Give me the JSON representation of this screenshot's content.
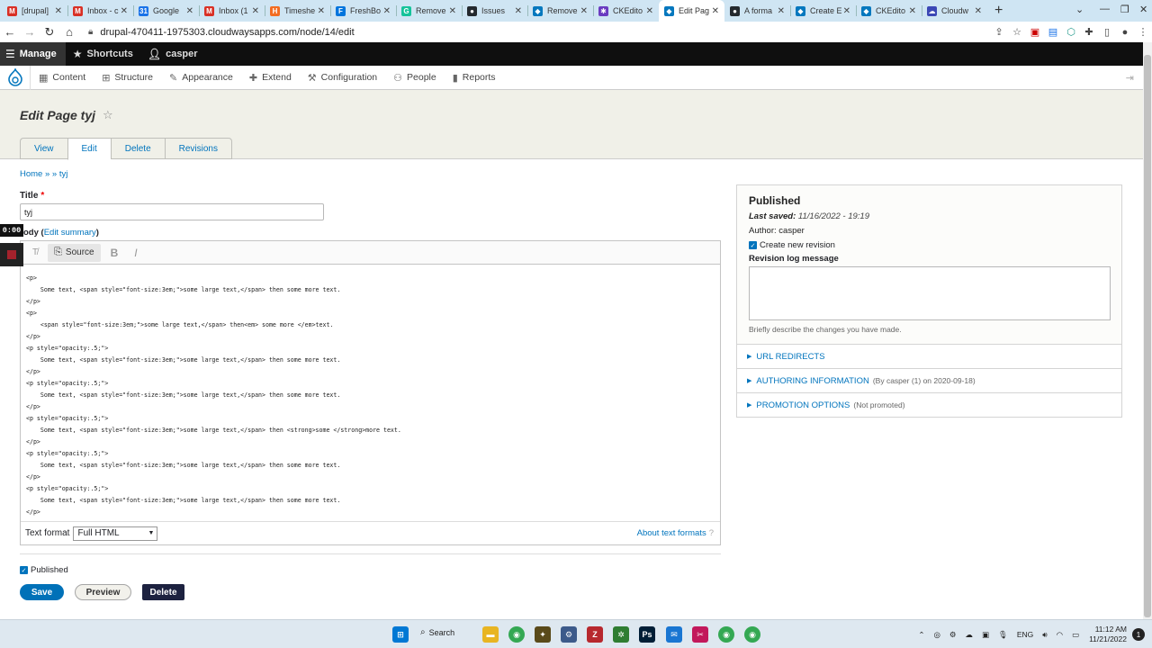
{
  "browser": {
    "tabs": [
      {
        "label": "[drupal]",
        "icon": "gmail-icon",
        "color": "#d93025",
        "glyph": "M"
      },
      {
        "label": "Inbox - c",
        "icon": "gmail-icon",
        "color": "#d93025",
        "glyph": "M"
      },
      {
        "label": "Google",
        "icon": "calendar-icon",
        "color": "#1a73e8",
        "glyph": "31"
      },
      {
        "label": "Inbox (1",
        "icon": "gmail-icon",
        "color": "#d93025",
        "glyph": "M"
      },
      {
        "label": "Timeshe",
        "icon": "harvest-icon",
        "color": "#f36c21",
        "glyph": "H"
      },
      {
        "label": "FreshBo",
        "icon": "freshbooks-icon",
        "color": "#0075dd",
        "glyph": "F"
      },
      {
        "label": "Remove",
        "icon": "grammarly-icon",
        "color": "#15c39a",
        "glyph": "G"
      },
      {
        "label": "Issues",
        "icon": "github-icon",
        "color": "#24292e",
        "glyph": "●"
      },
      {
        "label": "Remove",
        "icon": "drupal-icon",
        "color": "#0678be",
        "glyph": "◆"
      },
      {
        "label": "CKEdito",
        "icon": "ckeditor-icon",
        "color": "#6a3bc0",
        "glyph": "✱"
      },
      {
        "label": "Edit Pag",
        "icon": "drupal-icon",
        "color": "#0678be",
        "glyph": "◆",
        "active": true
      },
      {
        "label": "A forma",
        "icon": "github-icon",
        "color": "#24292e",
        "glyph": "●"
      },
      {
        "label": "Create E",
        "icon": "drupal-icon",
        "color": "#0678be",
        "glyph": "◆"
      },
      {
        "label": "CKEdito",
        "icon": "drupal-icon",
        "color": "#0678be",
        "glyph": "◆"
      },
      {
        "label": "Cloudw",
        "icon": "cloudways-icon",
        "color": "#3b47b5",
        "glyph": "☁"
      }
    ],
    "url": "drupal-470411-1975303.cloudwaysapps.com/node/14/edit"
  },
  "toolbar": {
    "manage": "Manage",
    "shortcuts": "Shortcuts",
    "user": "casper"
  },
  "tray": {
    "items": [
      "Content",
      "Structure",
      "Appearance",
      "Extend",
      "Configuration",
      "People",
      "Reports"
    ]
  },
  "page": {
    "title": "Edit Page tyj",
    "tabs": [
      "View",
      "Edit",
      "Delete",
      "Revisions"
    ],
    "breadcrumb": "Home » » tyj"
  },
  "form": {
    "title_label": "Title",
    "title_required": "*",
    "title_value": "tyj",
    "body_label": "ody (",
    "edit_summary": "Edit summary",
    "body_close": ")",
    "recorder_time": "0:00",
    "source_label": "Source",
    "source_lines": [
      "<p>",
      "    Some text, <span style=\"font-size:3em;\">some large text,</span> then some more text.",
      "</p>",
      "<p>",
      "    <span style=\"font-size:3em;\">some large text,</span> then<em> some more </em>text.",
      "</p>",
      "<p style=\"opacity:.5;\">",
      "    Some text, <span style=\"font-size:3em;\">some large text,</span> then some more text.",
      "</p>",
      "<p style=\"opacity:.5;\">",
      "    Some text, <span style=\"font-size:3em;\">some large text,</span> then some more text.",
      "</p>",
      "<p style=\"opacity:.5;\">",
      "    Some text, <span style=\"font-size:3em;\">some large text,</span> then <strong>some </strong>more text.",
      "</p>",
      "<p style=\"opacity:.5;\">",
      "    Some text, <span style=\"font-size:3em;\">some large text,</span> then some more text.",
      "</p>",
      "<p style=\"opacity:.5;\">",
      "    Some text, <span style=\"font-size:3em;\">some large text,</span> then some more text.",
      "</p>"
    ],
    "text_format_label": "Text format",
    "text_format_value": "Full HTML",
    "about_formats": "About text formats",
    "published_label": "Published",
    "save": "Save",
    "preview": "Preview",
    "delete": "Delete"
  },
  "sidebar": {
    "status": "Published",
    "last_saved_label": "Last saved:",
    "last_saved_value": "11/16/2022 - 19:19",
    "author_label": "Author:",
    "author_value": "casper",
    "new_revision": "Create new revision",
    "log_label": "Revision log message",
    "log_desc": "Briefly describe the changes you have made.",
    "details": [
      {
        "title": "URL REDIRECTS",
        "summary": ""
      },
      {
        "title": "AUTHORING INFORMATION",
        "summary": "(By casper (1) on 2020-09-18)"
      },
      {
        "title": "PROMOTION OPTIONS",
        "summary": "(Not promoted)"
      }
    ]
  },
  "taskbar": {
    "search": "Search",
    "lang": "ENG",
    "time": "11:12 AM",
    "date": "11/21/2022",
    "notifications": "1"
  }
}
